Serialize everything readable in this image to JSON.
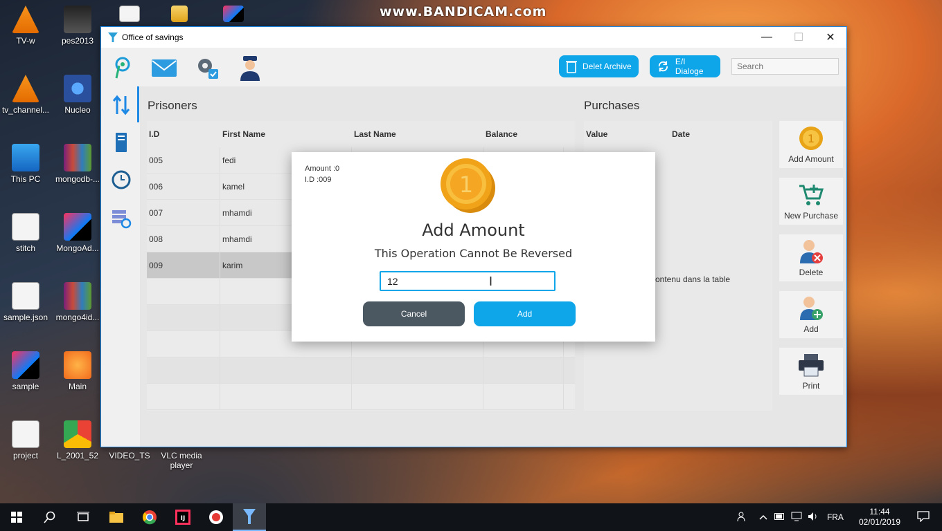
{
  "watermark": "www.BANDICAM.com",
  "desktop": {
    "icons": [
      {
        "label": "TV-w"
      },
      {
        "label": "pes2013"
      },
      {
        "label": "tv_channel..."
      },
      {
        "label": "Nucleo"
      },
      {
        "label": "This PC"
      },
      {
        "label": "mongodb-..."
      },
      {
        "label": "stitch"
      },
      {
        "label": "MongoAd..."
      },
      {
        "label": "sample.json"
      },
      {
        "label": "mongo4id..."
      },
      {
        "label": "sample"
      },
      {
        "label": "Main"
      },
      {
        "label": "project"
      },
      {
        "label": "L_2001_52"
      },
      {
        "label": "VIDEO_TS"
      },
      {
        "label": "VLC media player"
      }
    ]
  },
  "window": {
    "title": "Office of savings",
    "minimize": "—",
    "maximize": "☐",
    "close": "✕"
  },
  "toolbar": {
    "delete_archive": "Delet Archive",
    "ei_dialoge": "E/I Dialoge",
    "search_placeholder": "Search"
  },
  "prisoners": {
    "title": "Prisoners",
    "columns": [
      "I.D",
      "First Name",
      "Last Name",
      "Balance"
    ],
    "rows": [
      {
        "id": "005",
        "first": "fedi",
        "last": "",
        "balance": ""
      },
      {
        "id": "006",
        "first": "kamel",
        "last": "",
        "balance": ""
      },
      {
        "id": "007",
        "first": "mhamdi",
        "last": "",
        "balance": ""
      },
      {
        "id": "008",
        "first": "mhamdi",
        "last": "",
        "balance": ""
      },
      {
        "id": "009",
        "first": "karim",
        "last": "",
        "balance": ""
      }
    ],
    "selected_index": 4
  },
  "purchases": {
    "title": "Purchases",
    "columns": [
      "Value",
      "Date"
    ],
    "empty_message_visible": "ontenu dans la table"
  },
  "actions": [
    {
      "label": "Add Amount",
      "icon": "coin-icon"
    },
    {
      "label": "New Purchase",
      "icon": "cart-add-icon"
    },
    {
      "label": "Delete",
      "icon": "user-delete-icon"
    },
    {
      "label": "Add",
      "icon": "user-add-icon"
    },
    {
      "label": "Print",
      "icon": "printer-icon"
    }
  ],
  "dialog": {
    "amount_info": "Amount :0",
    "id_info": "I.D :009",
    "coin_label": "1",
    "title": "Add Amount",
    "subtitle": "This Operation Cannot Be Reversed",
    "input_value": "12",
    "cancel_label": "Cancel",
    "add_label": "Add"
  },
  "taskbar": {
    "language": "FRA",
    "time": "11:44",
    "date": "02/01/2019"
  },
  "colors": {
    "accent": "#0ea5e9",
    "cancel": "#4b5761",
    "window_border": "#1e88e5"
  }
}
